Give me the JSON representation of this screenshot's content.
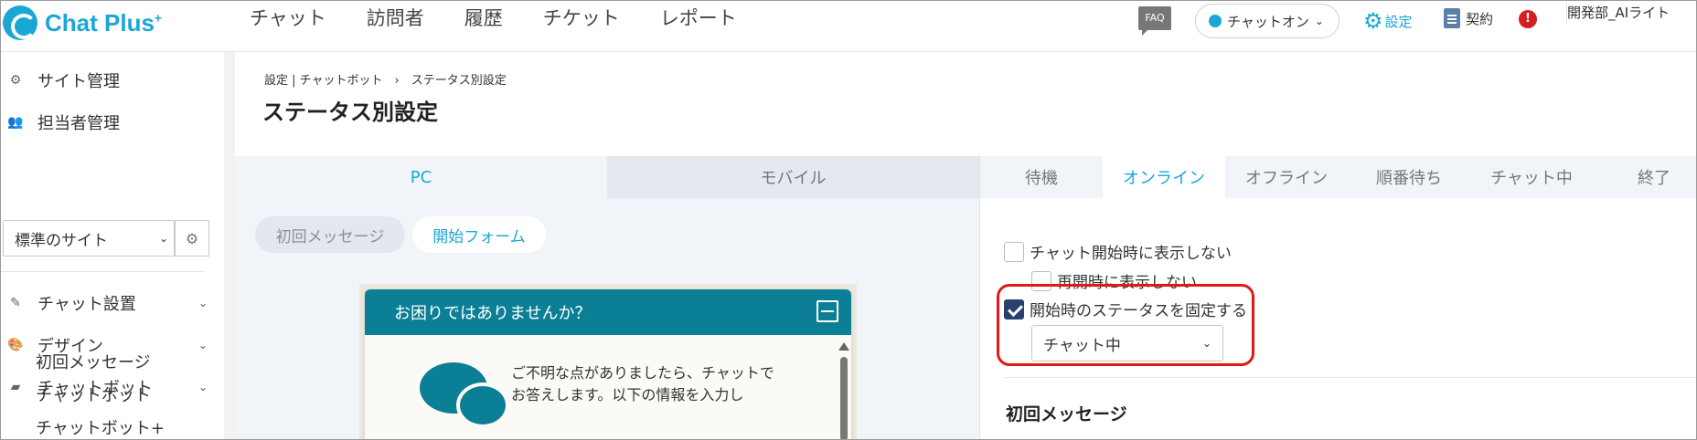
{
  "app": {
    "logo_text": "Chat Plus",
    "logo_sup": "+",
    "nav": [
      "チャット",
      "訪問者",
      "履歴",
      "チケット",
      "レポート"
    ],
    "faq": "FAQ",
    "status_label": "チャットオン",
    "settings_label": "設定",
    "contract_label": "契約",
    "alert_glyph": "!",
    "user_name": "開発部_AIライト"
  },
  "sidebar": {
    "site_admin": "サイト管理",
    "staff_admin": "担当者管理",
    "site_select": "標準のサイト",
    "chat_setup": "チャット設置",
    "design": "デザイン",
    "chatbot": "チャットボット",
    "sub_items": [
      "初回メッセージ",
      "チャットボット",
      "チャットボット+"
    ]
  },
  "main": {
    "breadcrumb": "設定 | チャットボット　›　ステータス別設定",
    "title": "ステータス別設定",
    "device_tabs": [
      "PC",
      "モバイル"
    ],
    "form_tabs": [
      "初回メッセージ",
      "開始フォーム"
    ],
    "widget": {
      "header": "お困りではありませんか？",
      "text": "ご不明な点がありましたら、チャットでお答えします。以下の情報を入力し"
    },
    "status_tabs": [
      "待機",
      "オンライン",
      "オフライン",
      "順番待ち",
      "チャット中",
      "終了"
    ],
    "options": {
      "hide_on_start": "チャット開始時に表示しない",
      "hide_on_reopen": "再開時に表示しない",
      "fix_status": "開始時のステータスを固定する",
      "status_value": "チャット中"
    },
    "section_heading": "初回メッセージ"
  },
  "colors": {
    "accent": "#1aa7d6",
    "widget_header": "#0b7f95",
    "highlight": "#e01818",
    "checkbox_checked": "#27406f"
  }
}
